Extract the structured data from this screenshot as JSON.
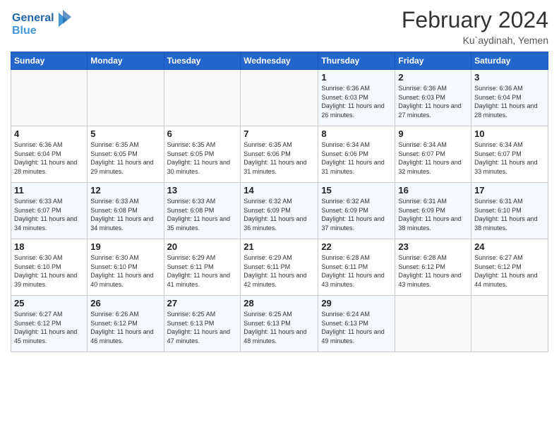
{
  "logo": {
    "line1": "General",
    "line2": "Blue"
  },
  "title": "February 2024",
  "location": "Ku`aydinah, Yemen",
  "days_of_week": [
    "Sunday",
    "Monday",
    "Tuesday",
    "Wednesday",
    "Thursday",
    "Friday",
    "Saturday"
  ],
  "weeks": [
    [
      {
        "day": "",
        "info": ""
      },
      {
        "day": "",
        "info": ""
      },
      {
        "day": "",
        "info": ""
      },
      {
        "day": "",
        "info": ""
      },
      {
        "day": "1",
        "info": "Sunrise: 6:36 AM\nSunset: 6:03 PM\nDaylight: 11 hours and 26 minutes."
      },
      {
        "day": "2",
        "info": "Sunrise: 6:36 AM\nSunset: 6:03 PM\nDaylight: 11 hours and 27 minutes."
      },
      {
        "day": "3",
        "info": "Sunrise: 6:36 AM\nSunset: 6:04 PM\nDaylight: 11 hours and 28 minutes."
      }
    ],
    [
      {
        "day": "4",
        "info": "Sunrise: 6:36 AM\nSunset: 6:04 PM\nDaylight: 11 hours and 28 minutes."
      },
      {
        "day": "5",
        "info": "Sunrise: 6:35 AM\nSunset: 6:05 PM\nDaylight: 11 hours and 29 minutes."
      },
      {
        "day": "6",
        "info": "Sunrise: 6:35 AM\nSunset: 6:05 PM\nDaylight: 11 hours and 30 minutes."
      },
      {
        "day": "7",
        "info": "Sunrise: 6:35 AM\nSunset: 6:06 PM\nDaylight: 11 hours and 31 minutes."
      },
      {
        "day": "8",
        "info": "Sunrise: 6:34 AM\nSunset: 6:06 PM\nDaylight: 11 hours and 31 minutes."
      },
      {
        "day": "9",
        "info": "Sunrise: 6:34 AM\nSunset: 6:07 PM\nDaylight: 11 hours and 32 minutes."
      },
      {
        "day": "10",
        "info": "Sunrise: 6:34 AM\nSunset: 6:07 PM\nDaylight: 11 hours and 33 minutes."
      }
    ],
    [
      {
        "day": "11",
        "info": "Sunrise: 6:33 AM\nSunset: 6:07 PM\nDaylight: 11 hours and 34 minutes."
      },
      {
        "day": "12",
        "info": "Sunrise: 6:33 AM\nSunset: 6:08 PM\nDaylight: 11 hours and 34 minutes."
      },
      {
        "day": "13",
        "info": "Sunrise: 6:33 AM\nSunset: 6:08 PM\nDaylight: 11 hours and 35 minutes."
      },
      {
        "day": "14",
        "info": "Sunrise: 6:32 AM\nSunset: 6:09 PM\nDaylight: 11 hours and 36 minutes."
      },
      {
        "day": "15",
        "info": "Sunrise: 6:32 AM\nSunset: 6:09 PM\nDaylight: 11 hours and 37 minutes."
      },
      {
        "day": "16",
        "info": "Sunrise: 6:31 AM\nSunset: 6:09 PM\nDaylight: 11 hours and 38 minutes."
      },
      {
        "day": "17",
        "info": "Sunrise: 6:31 AM\nSunset: 6:10 PM\nDaylight: 11 hours and 38 minutes."
      }
    ],
    [
      {
        "day": "18",
        "info": "Sunrise: 6:30 AM\nSunset: 6:10 PM\nDaylight: 11 hours and 39 minutes."
      },
      {
        "day": "19",
        "info": "Sunrise: 6:30 AM\nSunset: 6:10 PM\nDaylight: 11 hours and 40 minutes."
      },
      {
        "day": "20",
        "info": "Sunrise: 6:29 AM\nSunset: 6:11 PM\nDaylight: 11 hours and 41 minutes."
      },
      {
        "day": "21",
        "info": "Sunrise: 6:29 AM\nSunset: 6:11 PM\nDaylight: 11 hours and 42 minutes."
      },
      {
        "day": "22",
        "info": "Sunrise: 6:28 AM\nSunset: 6:11 PM\nDaylight: 11 hours and 43 minutes."
      },
      {
        "day": "23",
        "info": "Sunrise: 6:28 AM\nSunset: 6:12 PM\nDaylight: 11 hours and 43 minutes."
      },
      {
        "day": "24",
        "info": "Sunrise: 6:27 AM\nSunset: 6:12 PM\nDaylight: 11 hours and 44 minutes."
      }
    ],
    [
      {
        "day": "25",
        "info": "Sunrise: 6:27 AM\nSunset: 6:12 PM\nDaylight: 11 hours and 45 minutes."
      },
      {
        "day": "26",
        "info": "Sunrise: 6:26 AM\nSunset: 6:12 PM\nDaylight: 11 hours and 46 minutes."
      },
      {
        "day": "27",
        "info": "Sunrise: 6:25 AM\nSunset: 6:13 PM\nDaylight: 11 hours and 47 minutes."
      },
      {
        "day": "28",
        "info": "Sunrise: 6:25 AM\nSunset: 6:13 PM\nDaylight: 11 hours and 48 minutes."
      },
      {
        "day": "29",
        "info": "Sunrise: 6:24 AM\nSunset: 6:13 PM\nDaylight: 11 hours and 49 minutes."
      },
      {
        "day": "",
        "info": ""
      },
      {
        "day": "",
        "info": ""
      }
    ]
  ]
}
